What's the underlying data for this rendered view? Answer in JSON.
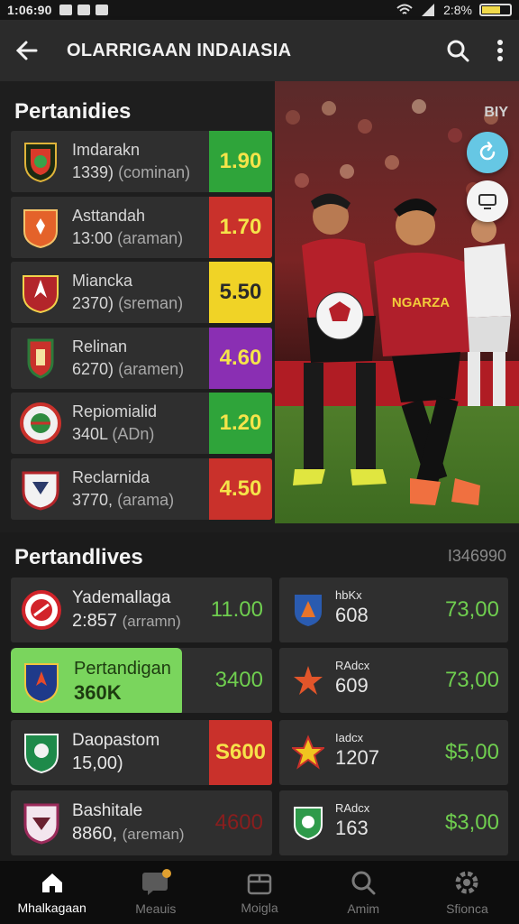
{
  "status_bar": {
    "time": "1:06:90",
    "battery": "2:8%"
  },
  "app_bar": {
    "title": "OLARRIGAAN INDAIASIA"
  },
  "section1": {
    "title": "Pertanidies",
    "photo_badge": "BIY",
    "jersey_text": "NGARZA",
    "matches": [
      {
        "name": "Imdarakn",
        "value": "1339)",
        "meta": "(cominan)",
        "odd": "1.90",
        "odd_color": "#2fa43a",
        "odd_text": "#f5e44a"
      },
      {
        "name": "Asttandah",
        "value": "13:00",
        "meta": "(araman)",
        "odd": "1.70",
        "odd_color": "#c9312b",
        "odd_text": "#f5e44a"
      },
      {
        "name": "Miancka",
        "value": "2370)",
        "meta": "(sreman)",
        "odd": "5.50",
        "odd_color": "#f0d326",
        "odd_text": "#2a2a2a"
      },
      {
        "name": "Relinan",
        "value": "6270)",
        "meta": "(aramen)",
        "odd": "4.60",
        "odd_color": "#8a2fb3",
        "odd_text": "#f5e44a"
      },
      {
        "name": "Repiomialid",
        "value": "340L",
        "meta": "(ADn)",
        "odd": "1.20",
        "odd_color": "#2fa43a",
        "odd_text": "#f5e44a"
      },
      {
        "name": "Reclarnida",
        "value": "3770,",
        "meta": "(arama)",
        "odd": "4.50",
        "odd_color": "#c9312b",
        "odd_text": "#f5e44a"
      }
    ]
  },
  "section2": {
    "title": "Pertandlives",
    "count": "I346990",
    "left": [
      {
        "name": "Yademallaga",
        "value": "2:857",
        "meta": "(arramn)",
        "odd": "11.00"
      },
      {
        "name": "Pertandigan",
        "value": "360K",
        "meta": "",
        "odd": "3400"
      },
      {
        "name": "Daopastom",
        "value": "15,00)",
        "meta": "",
        "odd": "S600"
      },
      {
        "name": "Bashitale",
        "value": "8860,",
        "meta": "(areman)",
        "odd": "4600"
      }
    ],
    "right": [
      {
        "name": "hbKx",
        "value": "608",
        "odd": "73,00"
      },
      {
        "name": "RAdcx",
        "value": "609",
        "odd": "73,00"
      },
      {
        "name": "Iadcx",
        "value": "1207",
        "odd": "$5,00"
      },
      {
        "name": "RAdcx",
        "value": "163",
        "odd": "$3,00"
      }
    ]
  },
  "bottom_nav": [
    {
      "label": "Mhalkagaan",
      "icon": "home-icon"
    },
    {
      "label": "Meauis",
      "icon": "chat-icon"
    },
    {
      "label": "Moigla",
      "icon": "box-icon"
    },
    {
      "label": "Amim",
      "icon": "search-icon"
    },
    {
      "label": "Sfionca",
      "icon": "gear-icon"
    }
  ],
  "colors": {
    "accent_green": "#7ad55d",
    "odd_green": "#6fce4f",
    "red": "#c9312b"
  }
}
